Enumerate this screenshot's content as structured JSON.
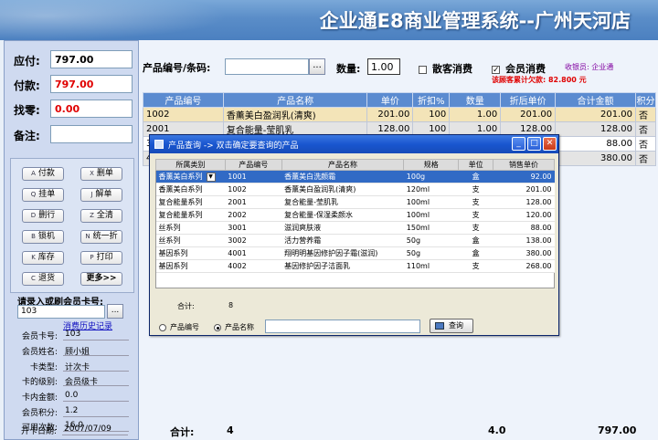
{
  "app": {
    "title": "企业通E8商业管理系统--广州天河店"
  },
  "payment": {
    "due_label": "应付:",
    "due_value": "797.00",
    "paid_label": "付款:",
    "paid_value": "797.00",
    "change_label": "找零:",
    "change_value": "0.00",
    "note_label": "备注:",
    "note_value": ""
  },
  "function_buttons": [
    {
      "key": "A",
      "label": "付款"
    },
    {
      "key": "X",
      "label": "删单"
    },
    {
      "key": "Q",
      "label": "挂单"
    },
    {
      "key": "J",
      "label": "解单"
    },
    {
      "key": "D",
      "label": "删行"
    },
    {
      "key": "Z",
      "label": "全清"
    },
    {
      "key": "B",
      "label": "锁机"
    },
    {
      "key": "N",
      "label": "统一折"
    },
    {
      "key": "K",
      "label": "库存"
    },
    {
      "key": "P",
      "label": "打印"
    },
    {
      "key": "C",
      "label": "退货"
    },
    {
      "key": "",
      "label": "更多>>"
    }
  ],
  "member": {
    "card_input_label": "请录入或刷会员卡号:",
    "card_input_value": "103",
    "card_dots": "...",
    "history_link": "消费历史记录",
    "fields": [
      {
        "label": "会员卡号:",
        "value": "103"
      },
      {
        "label": "会员姓名:",
        "value": "顾小姐"
      },
      {
        "label": "卡类型:",
        "value": "计次卡"
      },
      {
        "label": "卡的级别:",
        "value": "会员级卡"
      },
      {
        "label": "卡内金额:",
        "value": "0.0"
      },
      {
        "label": "会员积分:",
        "value": "1.2"
      },
      {
        "label": "可用次数:",
        "value": "16.0"
      },
      {
        "label": "开卡日期:",
        "value": "2007/07/09"
      }
    ]
  },
  "entry": {
    "code_label": "产品编号/条码:",
    "code_value": "",
    "code_dots": "...",
    "qty_label": "数量:",
    "qty_value": "1.00",
    "walkin_label": "散客消费",
    "walkin_checked": false,
    "member_label": "会员消费",
    "member_checked": true,
    "member_check_mark": "✓",
    "cashier_text": "收银员: 企业通",
    "debt_text": "该顾客累计欠款: 82.800 元"
  },
  "main_table": {
    "headers": [
      "产品编号",
      "产品名称",
      "单价",
      "折扣%",
      "数量",
      "折后单价",
      "合计金额",
      "积分"
    ],
    "rows": [
      [
        "1002",
        "香薰美白盈润乳(清爽)",
        "201.00",
        "100",
        "1.00",
        "201.00",
        "201.00",
        "否"
      ],
      [
        "2001",
        "复合能量-莹肌乳",
        "128.00",
        "100",
        "1.00",
        "128.00",
        "128.00",
        "否"
      ],
      [
        "3",
        "",
        "",
        "",
        "",
        "",
        "88.00",
        "否"
      ],
      [
        "4",
        "",
        "",
        "",
        "",
        "",
        "380.00",
        "否"
      ]
    ]
  },
  "totals": {
    "label": "合计:",
    "qty_count": "4",
    "qty_total": "4.0",
    "amount": "797.00"
  },
  "dialog": {
    "title": "产品查询  -> 双击确定要查询的产品",
    "min": "_",
    "max": "□",
    "close": "✕",
    "headers": [
      "所属类别",
      "产品编号",
      "产品名称",
      "规格",
      "单位",
      "销售单价"
    ],
    "rows": [
      [
        "香薰美白系列",
        "1001",
        "香薰美白洗颜霜",
        "100g",
        "盒",
        "92.00"
      ],
      [
        "香薰美白系列",
        "1002",
        "香薰美白盈润乳(清爽)",
        "120ml",
        "支",
        "201.00"
      ],
      [
        "复合能量系列",
        "2001",
        "复合能量-莹肌乳",
        "100ml",
        "支",
        "128.00"
      ],
      [
        "复合能量系列",
        "2002",
        "复合能量-保湿柔颜水",
        "100ml",
        "支",
        "120.00"
      ],
      [
        "丝系列",
        "3001",
        "滋润爽肤液",
        "150ml",
        "支",
        "88.00"
      ],
      [
        "丝系列",
        "3002",
        "活力营养霜",
        "50g",
        "盒",
        "138.00"
      ],
      [
        "基因系列",
        "4001",
        "翔明明基因修护因子霜(滋润)",
        "50g",
        "盒",
        "380.00"
      ],
      [
        "基因系列",
        "4002",
        "基因修护因子洁面乳",
        "110ml",
        "支",
        "268.00"
      ]
    ],
    "count_label": "合计:",
    "count_value": "8",
    "radio_code": "产品编号",
    "radio_name": "产品名称",
    "search_value": "",
    "query_button": "查询"
  }
}
